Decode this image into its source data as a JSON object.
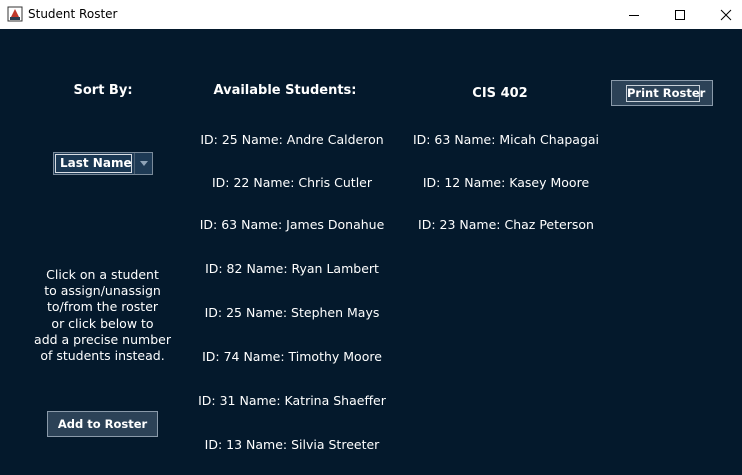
{
  "window": {
    "title": "Student Roster",
    "icon": "java-app-icon"
  },
  "sort": {
    "label": "Sort By:",
    "selected": "Last Name"
  },
  "available": {
    "heading": "Available Students:",
    "students": [
      "ID: 25 Name: Andre Calderon",
      "ID: 22 Name: Chris Cutler",
      "ID: 63 Name: James Donahue",
      "ID: 82 Name: Ryan Lambert",
      "ID: 25 Name: Stephen Mays",
      "ID: 74 Name: Timothy Moore",
      "ID: 31 Name: Katrina Shaeffer",
      "ID: 13 Name: Silvia Streeter"
    ]
  },
  "roster": {
    "title": "CIS 402",
    "students": [
      "ID: 63 Name: Micah Chapagai",
      "ID: 12 Name: Kasey Moore",
      "ID: 23 Name: Chaz Peterson"
    ]
  },
  "buttons": {
    "print": "Print Roster",
    "add": "Add to Roster"
  },
  "instructions": "Click on a student\nto assign/unassign\nto/from the roster\nor click below to\nadd a precise number\nof students instead.",
  "colors": {
    "background": "#04192c",
    "text": "#ffffff",
    "button": "#2c4257"
  }
}
